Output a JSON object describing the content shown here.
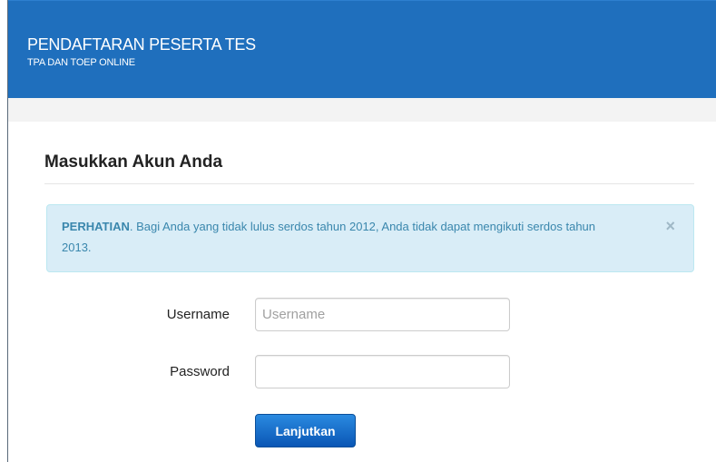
{
  "header": {
    "title": "PENDAFTARAN PESERTA TES",
    "subtitle": "TPA DAN TOEP ONLINE"
  },
  "login": {
    "section_title": "Masukkan Akun Anda",
    "alert": {
      "strong": "PERHATIAN",
      "message": ". Bagi Anda yang tidak lulus serdos tahun 2012, Anda tidak dapat mengikuti serdos tahun 2013.",
      "close": "×"
    },
    "username_label": "Username",
    "username_placeholder": "Username",
    "username_value": "",
    "password_label": "Password",
    "password_value": "",
    "submit_label": "Lanjutkan"
  },
  "colors": {
    "header_bg": "#1f6fbd",
    "alert_bg": "#d9edf7",
    "alert_text": "#3a87ad",
    "button_bg": "#0a56b5"
  }
}
